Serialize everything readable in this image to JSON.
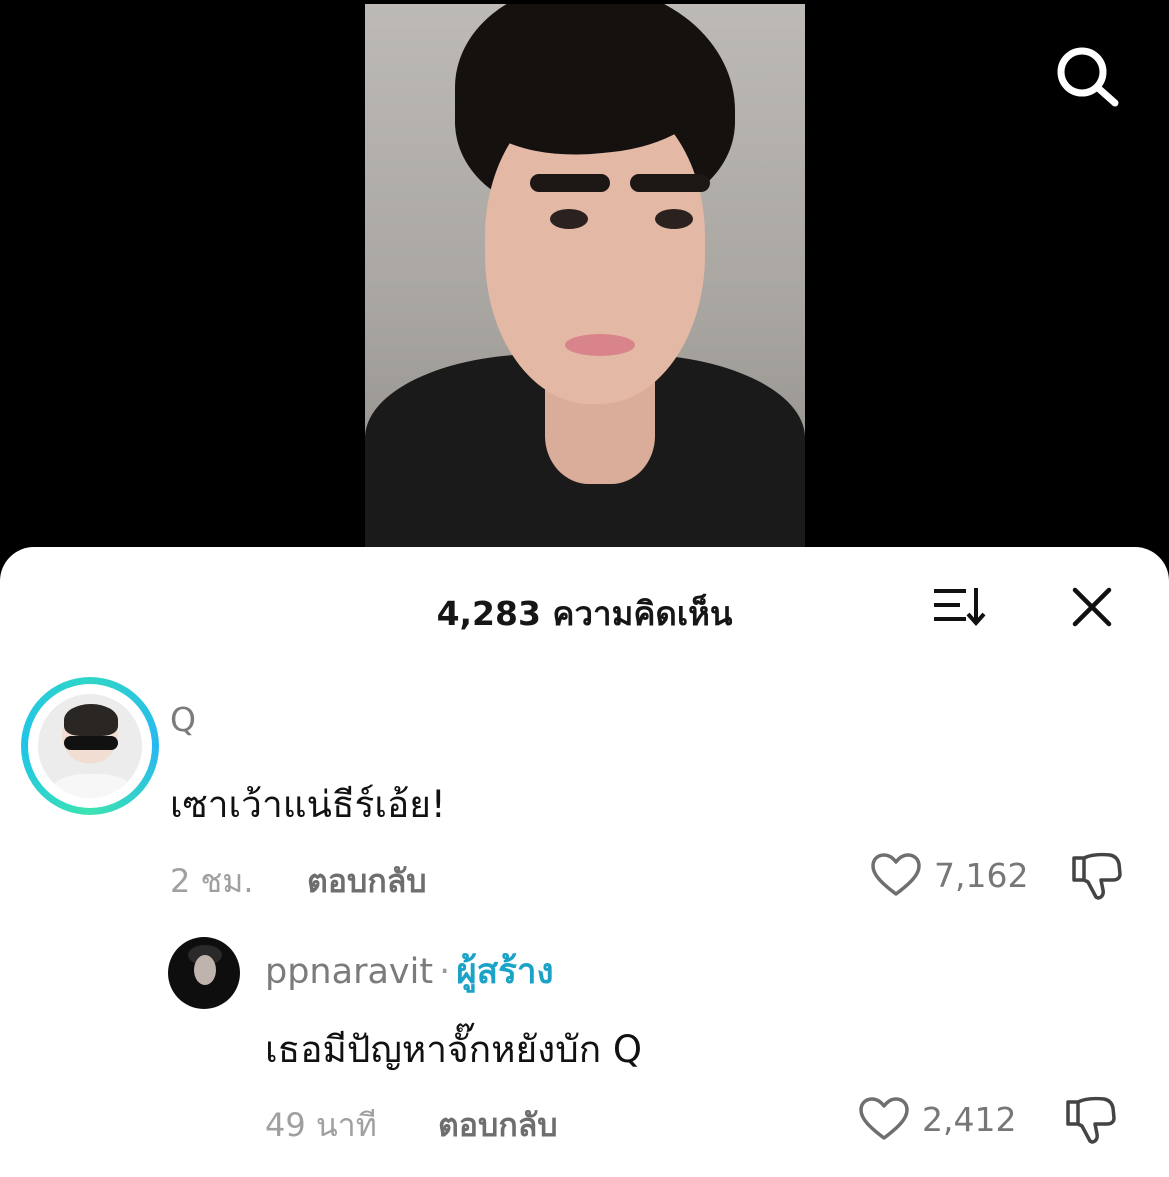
{
  "sheet": {
    "title": "4,283 ความคิดเห็น",
    "sort_icon": "sort-icon",
    "close_icon": "close-icon"
  },
  "top_bar": {
    "search_icon": "search-icon"
  },
  "comments": [
    {
      "username": "Q",
      "text": "เซาเว้าแน่ธีร์เอ้ย!",
      "time": "2 ชม.",
      "reply_label": "ตอบกลับ",
      "likes": "7,162",
      "avatar_ring_color": "#2fd6c6"
    }
  ],
  "replies": [
    {
      "username": "ppnaravit",
      "separator": "·",
      "badge": "ผู้สร้าง",
      "text": "เธอมีปัญหาจั๊กหยังบัก Q",
      "time": "49 นาที",
      "reply_label": "ตอบกลับ",
      "likes": "2,412",
      "badge_color": "#1aa3c7"
    }
  ]
}
